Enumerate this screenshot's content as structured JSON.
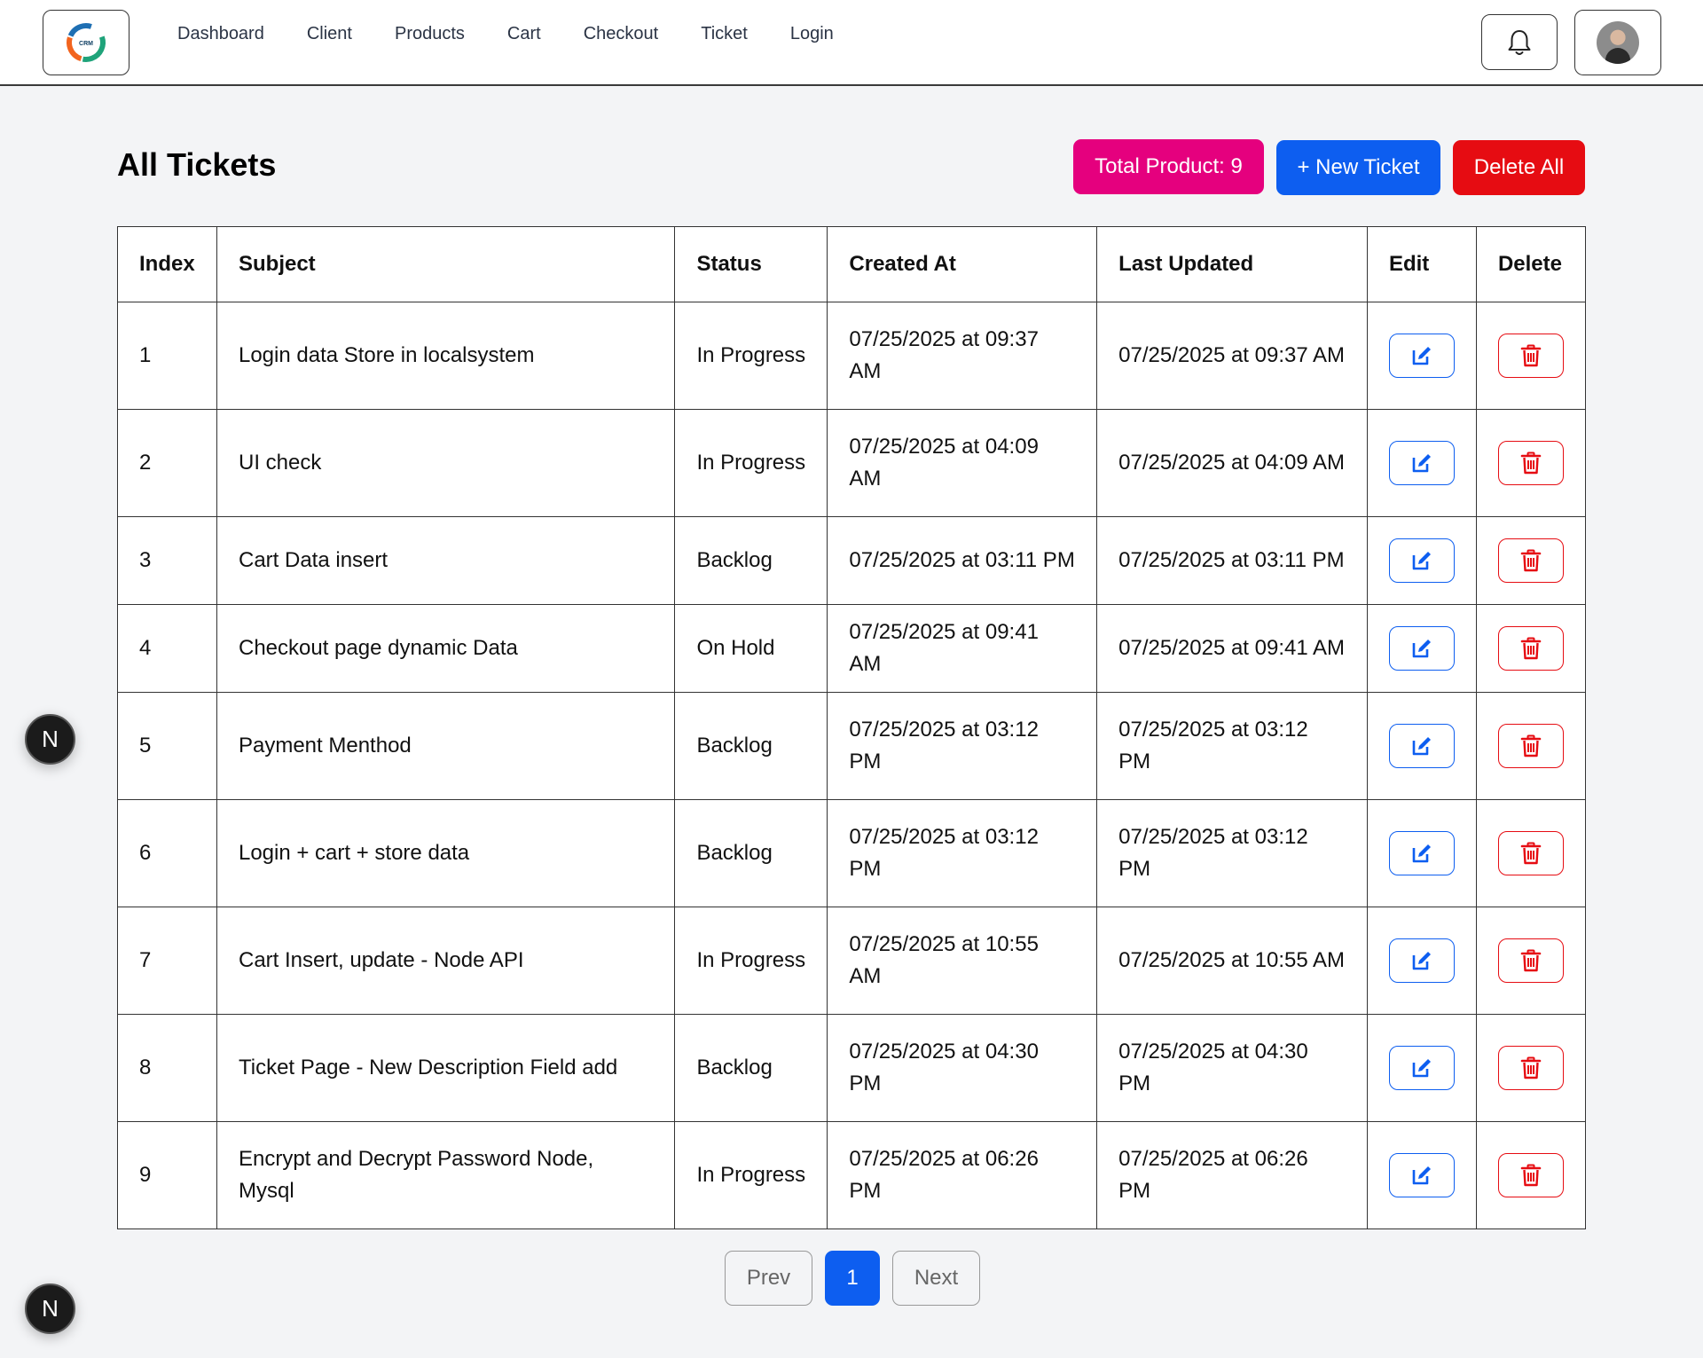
{
  "nav": {
    "logo_text": "CRM",
    "links": [
      "Dashboard",
      "Client",
      "Products",
      "Cart",
      "Checkout",
      "Ticket",
      "Login"
    ]
  },
  "header": {
    "title": "All Tickets",
    "total_label": "Total Product: 9",
    "new_label": "+ New Ticket",
    "delete_all_label": "Delete All"
  },
  "table": {
    "columns": [
      "Index",
      "Subject",
      "Status",
      "Created At",
      "Last Updated",
      "Edit",
      "Delete"
    ],
    "rows": [
      {
        "index": "1",
        "subject": "Login data Store in localsystem",
        "status": "In Progress",
        "created": "07/25/2025 at 09:37 AM",
        "updated": "07/25/2025 at 09:37 AM"
      },
      {
        "index": "2",
        "subject": "UI check",
        "status": "In Progress",
        "created": "07/25/2025 at 04:09 AM",
        "updated": "07/25/2025 at 04:09 AM"
      },
      {
        "index": "3",
        "subject": "Cart Data insert",
        "status": "Backlog",
        "created": "07/25/2025 at 03:11 PM",
        "updated": "07/25/2025 at 03:11 PM"
      },
      {
        "index": "4",
        "subject": "Checkout page dynamic Data",
        "status": "On Hold",
        "created": "07/25/2025 at 09:41 AM",
        "updated": "07/25/2025 at 09:41 AM"
      },
      {
        "index": "5",
        "subject": "Payment Menthod",
        "status": "Backlog",
        "created": "07/25/2025 at 03:12 PM",
        "updated": "07/25/2025 at 03:12 PM"
      },
      {
        "index": "6",
        "subject": "Login + cart + store data",
        "status": "Backlog",
        "created": "07/25/2025 at 03:12 PM",
        "updated": "07/25/2025 at 03:12 PM"
      },
      {
        "index": "7",
        "subject": "Cart Insert, update - Node API",
        "status": "In Progress",
        "created": "07/25/2025 at 10:55 AM",
        "updated": "07/25/2025 at 10:55 AM"
      },
      {
        "index": "8",
        "subject": "Ticket Page - New Description Field add",
        "status": "Backlog",
        "created": "07/25/2025 at 04:30 PM",
        "updated": "07/25/2025 at 04:30 PM"
      },
      {
        "index": "9",
        "subject": "Encrypt and Decrypt Password Node, Mysql",
        "status": "In Progress",
        "created": "07/25/2025 at 06:26 PM",
        "updated": "07/25/2025 at 06:26 PM"
      }
    ]
  },
  "pagination": {
    "prev_label": "Prev",
    "current_page": "1",
    "next_label": "Next"
  },
  "badge": {
    "letter": "N"
  },
  "colors": {
    "total_pink": "#e5007e",
    "primary_blue": "#0d5ef0",
    "danger_red": "#e60c12"
  },
  "icons": {
    "notification": "bell-icon",
    "edit": "edit-icon",
    "delete": "trash-icon"
  }
}
